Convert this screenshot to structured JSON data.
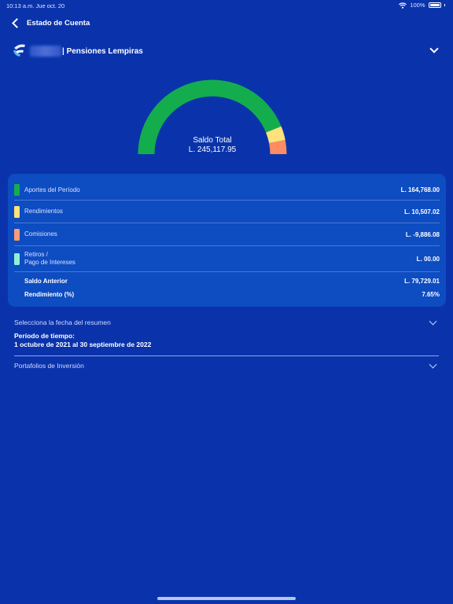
{
  "status": {
    "time_date": "10:13 a.m.   Jue oct. 20",
    "battery": "100%"
  },
  "nav": {
    "title": "Estado de Cuenta"
  },
  "account": {
    "name": "| Pensiones Lempiras"
  },
  "gauge": {
    "title": "Saldo Total",
    "total": "L. 245,117.95",
    "colors": {
      "aportes": "#14ad4d",
      "rendimientos": "#ffe27a",
      "comisiones": "#ff8c63"
    }
  },
  "summary": {
    "rows": [
      {
        "label": "Aportes del Período",
        "value": "L. 164,768.00",
        "color": "#14ad4d"
      },
      {
        "label": "Rendimientos",
        "value": "L. 10,507.02",
        "color": "#ffe27a"
      },
      {
        "label": "Comisiones",
        "value": "L. -9,886.08",
        "color": "#ff9a76"
      },
      {
        "label": "Retiros /",
        "label2": "Pago de Intereses",
        "value": "L. 00.00",
        "color": "#8ff0d6"
      }
    ],
    "saldo_anterior": {
      "label": "Saldo Anterior",
      "value": "L. 79,729.01"
    },
    "rendimiento": {
      "label": "Rendimiento (%)",
      "value": "7.65%"
    }
  },
  "date_selector": {
    "label": "Selecciona la fecha del resumen",
    "period_title": "Período de tiempo:",
    "period_value": "1 octubre de 2021 al 30 septiembre de 2022"
  },
  "portfolios": {
    "label": "Portafolios de Inversión"
  }
}
